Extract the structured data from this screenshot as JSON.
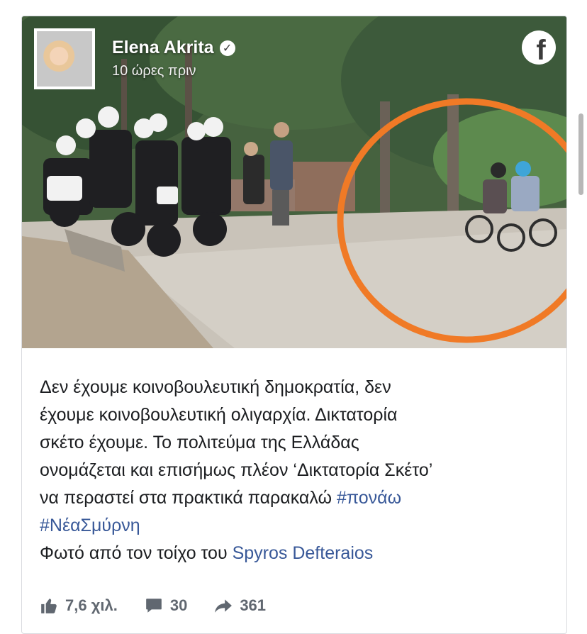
{
  "post": {
    "author": "Elena Akrita",
    "time": "10 ώρες πριν",
    "text_line1": "Δεν έχουμε κοινοβουλευτική δημοκρατία, δεν",
    "text_line2": "έχουμε κοινοβουλευτική ολιγαρχία. Δικτατορία",
    "text_line3": "σκέτο έχουμε. Το πολιτεύμα της Ελλάδας",
    "text_line4": "ονομάζεται και επισήμως πλέον ‘Δικτατορία Σκέτο’",
    "text_line5": "να περαστεί στα πρακτικά παρακαλώ",
    "hashtag1": "#πονάω",
    "hashtag2": "#ΝέαΣμύρνη",
    "photo_credit_prefix": "Φωτό από τον τοίχο του",
    "photo_credit_link": "Spyros Defteraios"
  },
  "stats": {
    "likes": "7,6 χιλ.",
    "comments": "30",
    "shares": "361"
  },
  "colors": {
    "link": "#385898",
    "text": "#1c1e21",
    "muted": "#606770",
    "circle": "#f07a26"
  },
  "icons": [
    "facebook-icon",
    "verified-icon",
    "like-icon",
    "comment-icon",
    "share-icon"
  ]
}
